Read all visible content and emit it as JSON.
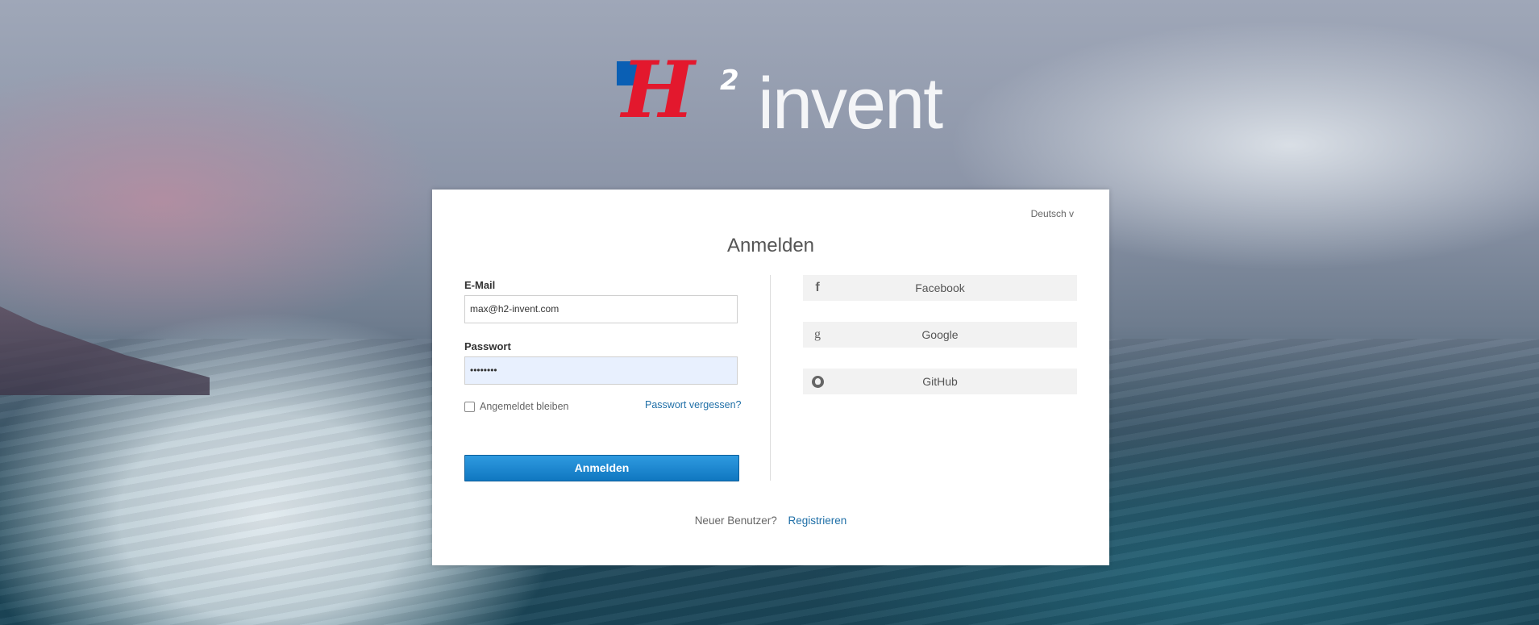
{
  "brand": {
    "logo_mark": "H",
    "logo_sup": "2",
    "logo_word": "invent",
    "colors": {
      "square": "#0a5fb4",
      "mark": "#e3182d",
      "word": "#f4f5f7"
    }
  },
  "language": {
    "selected": "Deutsch",
    "caret": "v"
  },
  "login": {
    "title": "Anmelden",
    "email_label": "E-Mail",
    "email_value": "max@h2-invent.com",
    "password_label": "Passwort",
    "password_value": "••••••••",
    "remember_label": "Angemeldet bleiben",
    "remember_checked": false,
    "forgot_label": "Passwort vergessen?",
    "submit_label": "Anmelden"
  },
  "social": [
    {
      "label": "Facebook",
      "icon": "facebook-icon"
    },
    {
      "label": "Google",
      "icon": "google-icon"
    },
    {
      "label": "GitHub",
      "icon": "github-icon"
    }
  ],
  "footer": {
    "prompt": "Neuer Benutzer?",
    "register_label": "Registrieren"
  },
  "accent_colors": {
    "primary": "#1a86cf",
    "link": "#1f6fa7"
  }
}
